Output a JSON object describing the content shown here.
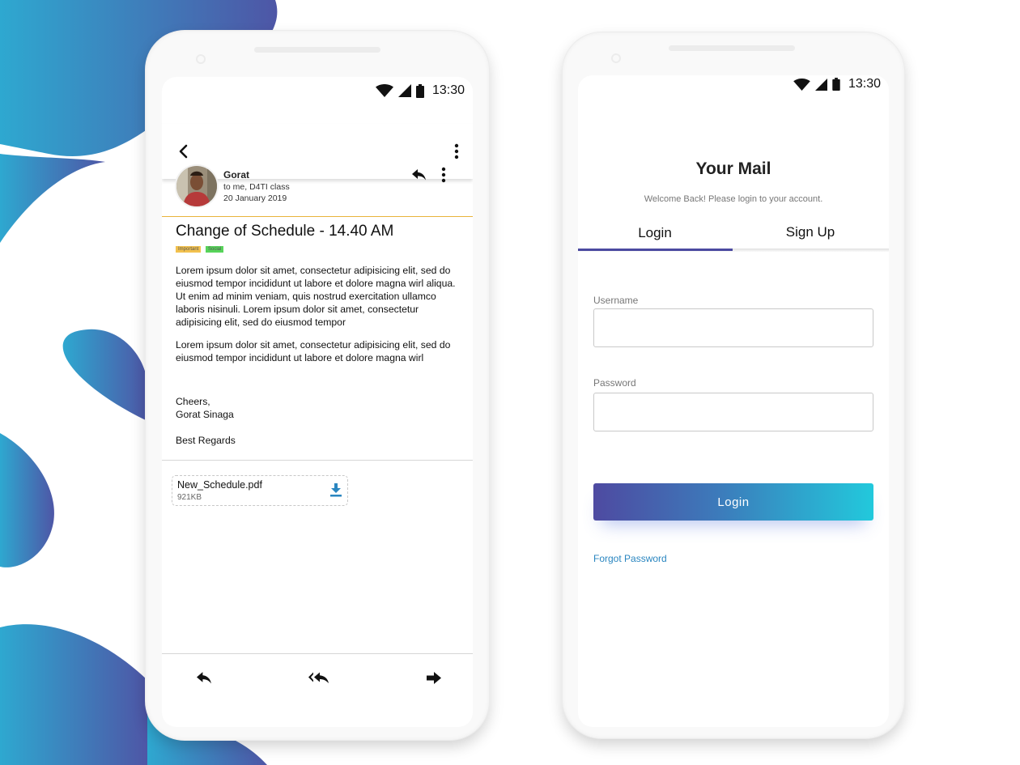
{
  "email_screen": {
    "status_time": "13:30",
    "sender_name": "Gorat",
    "recipients": "to me, D4TI class",
    "date": "20 January 2019",
    "subject": "Change of Schedule - 14.40 AM",
    "tags": [
      {
        "label": "Important",
        "color": "#f2c14e"
      },
      {
        "label": "Social",
        "color": "#57d45a"
      }
    ],
    "paragraph1": "Lorem ipsum dolor sit amet, consectetur adipisicing elit, sed do eiusmod tempor incididunt ut labore et dolore magna wirl aliqua. Ut enim ad minim veniam, quis nostrud exercitation ullamco laboris nisinuli. Lorem ipsum dolor sit amet, consectetur adipisicing elit, sed do eiusmod tempor",
    "paragraph2": "Lorem ipsum dolor sit amet, consectetur adipisicing elit, sed do eiusmod tempor incididunt ut labore et dolore magna wirl",
    "signoff_line1": "Cheers,",
    "signoff_line2": "Gorat Sinaga",
    "regards": "Best Regards",
    "attachment": {
      "name": "New_Schedule.pdf",
      "size": "921KB"
    }
  },
  "login_screen": {
    "status_time": "13:30",
    "app_title": "Your Mail",
    "subtitle": "Welcome Back! Please login to your account.",
    "tabs": [
      {
        "label": "Login"
      },
      {
        "label": "Sign Up"
      }
    ],
    "username_label": "Username",
    "password_label": "Password",
    "login_button": "Login",
    "forgot_password": "Forgot Password"
  },
  "colors": {
    "accent_purple": "#4b4aa0",
    "accent_cyan": "#22c9dc",
    "link_blue": "#2a86c0",
    "divider_gold": "#e9b43b"
  }
}
